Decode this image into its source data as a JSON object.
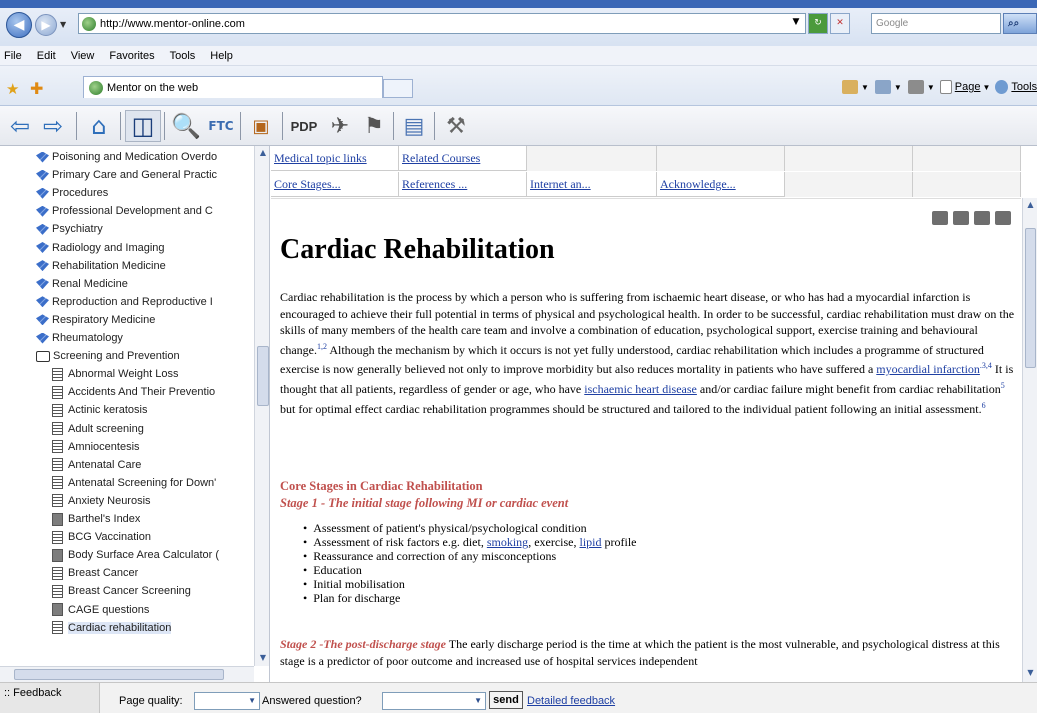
{
  "browser": {
    "url": "http://www.mentor-online.com",
    "search_placeholder": "Google",
    "menu": [
      "File",
      "Edit",
      "View",
      "Favorites",
      "Tools",
      "Help"
    ],
    "tab_title": "Mentor on the web",
    "cmd_page": "Page",
    "cmd_tools": "Tools"
  },
  "toolbar": {
    "pdp_label": "PDP"
  },
  "tree": {
    "items": [
      {
        "label": "Poisoning and Medication Overdo",
        "icon": "book"
      },
      {
        "label": "Primary Care and General Practic",
        "icon": "book"
      },
      {
        "label": "Procedures",
        "icon": "book"
      },
      {
        "label": "Professional Development and C",
        "icon": "book"
      },
      {
        "label": "Psychiatry",
        "icon": "book"
      },
      {
        "label": "Radiology and Imaging",
        "icon": "book"
      },
      {
        "label": "Rehabilitation Medicine",
        "icon": "book"
      },
      {
        "label": "Renal Medicine",
        "icon": "book"
      },
      {
        "label": "Reproduction and Reproductive I",
        "icon": "book"
      },
      {
        "label": "Respiratory Medicine",
        "icon": "book"
      },
      {
        "label": "Rheumatology",
        "icon": "book"
      },
      {
        "label": "Screening and Prevention",
        "icon": "open-book"
      },
      {
        "label": "Abnormal Weight Loss",
        "icon": "doc"
      },
      {
        "label": "Accidents And Their Preventio",
        "icon": "doc"
      },
      {
        "label": "Actinic keratosis",
        "icon": "doc"
      },
      {
        "label": "Adult screening",
        "icon": "doc"
      },
      {
        "label": "Amniocentesis",
        "icon": "doc"
      },
      {
        "label": "Antenatal Care",
        "icon": "doc"
      },
      {
        "label": "Antenatal Screening for Down'",
        "icon": "doc"
      },
      {
        "label": "Anxiety Neurosis",
        "icon": "doc"
      },
      {
        "label": "Barthel's Index",
        "icon": "calc"
      },
      {
        "label": "BCG Vaccination",
        "icon": "doc"
      },
      {
        "label": "Body Surface Area Calculator (",
        "icon": "calc"
      },
      {
        "label": "Breast Cancer",
        "icon": "doc"
      },
      {
        "label": "Breast Cancer Screening",
        "icon": "doc"
      },
      {
        "label": "CAGE questions",
        "icon": "calc"
      },
      {
        "label": "Cardiac rehabilitation",
        "icon": "doc",
        "selected": true
      }
    ]
  },
  "links": {
    "row1": [
      "Medical topic links",
      "Related Courses"
    ],
    "row2": [
      "Core Stages...",
      "References ...",
      "Internet an...",
      "Acknowledge..."
    ]
  },
  "article": {
    "title": "Cardiac Rehabilitation",
    "p1_a": "Cardiac rehabilitation is the process by which a person who is suffering from ischaemic heart disease, or who has had a myocardial infarction is encouraged to achieve their full potential in terms of physical and psychological health. In order to be successful, cardiac rehabilitation must draw on the skills of many members of the health care team and involve a combination of education, psychological support, exercise training and behavioural change.",
    "sup1": "1,2",
    "p1_b": " Although the mechanism by which it occurs is not yet fully understood, cardiac rehabilitation which includes a programme of structured exercise is now generally believed not only to improve morbidity but also reduces mortality in patients who have suffered a ",
    "link_mi": "myocardial infarction",
    "sup2": ".3,4",
    "p1_c": " It is thought that all patients, regardless of gender or age, who have ",
    "link_ihd": "ischaemic heart disease",
    "p1_d": " and/or cardiac failure might benefit from cardiac rehabilitation",
    "sup3": "5",
    "p1_e": " but for optimal effect cardiac rehabilitation programmes should be structured and tailored to the individual patient following an initial assessment.",
    "sup4": "6",
    "section_heading": "Core Stages in Cardiac Rehabilitation",
    "stage1_heading": "Stage 1 - The initial stage following MI or cardiac event",
    "bullets": {
      "b1": "Assessment of patient's physical/psychological condition",
      "b2_pre": "Assessment of risk factors e.g. diet, ",
      "b2_smoking": "smoking",
      "b2_mid": ", exercise, ",
      "b2_lipid": "lipid",
      "b2_post": " profile",
      "b3": "Reassurance and correction of any misconceptions",
      "b4": "Education",
      "b5": "Initial mobilisation",
      "b6": "Plan for discharge"
    },
    "stage2_label": "Stage 2 -The post-discharge stage",
    "stage2_text": " The early discharge period is the time at which the patient is the most vulnerable, and psychological distress at this stage is a predictor of poor outcome and increased use of hospital services independent"
  },
  "feedback": {
    "tab": ":: Feedback",
    "page_quality": "Page quality:",
    "answered": "Answered question?",
    "send": "send",
    "detailed": "Detailed feedback"
  }
}
